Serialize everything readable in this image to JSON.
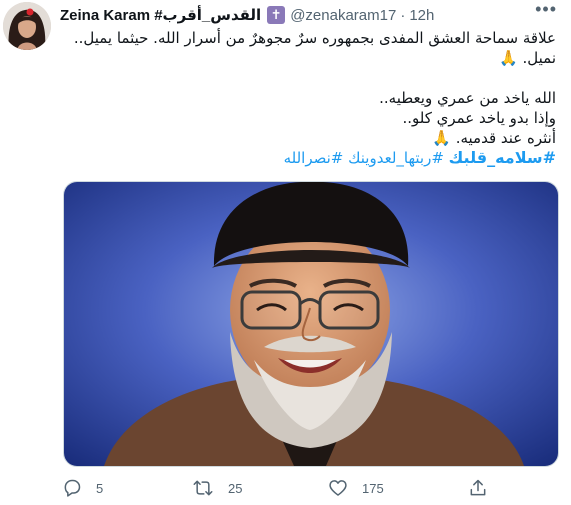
{
  "tweet": {
    "display_name": "Zeina Karam #القدس_أقرب",
    "badge_glyph": "✝",
    "handle": "@zenakaram17",
    "separator": "·",
    "time": "12h",
    "more_label": "•••",
    "lines": [
      "علاقة سماحة العشق المفدى بجمهوره سرٌ مجوهرٌ من أسرار الله. حيثما يميل..",
      "نميل. 🙏",
      "",
      "الله ياخد من عمري ويعطيه..",
      "وإذا بدو ياخد عمري كلو..",
      "أنثره عند قدميه. 🙏"
    ],
    "hashtag_main": "#سلامه_قلبك",
    "hashtag_rest": " #ربتها_لعدوينك #نصرالله",
    "actions": {
      "reply_count": "5",
      "retweet_count": "25",
      "like_count": "175"
    }
  },
  "icons": {
    "avatar": "profile-photo",
    "media": "portrait-photo",
    "reply": "reply-icon",
    "retweet": "retweet-icon",
    "like": "heart-icon",
    "share": "share-icon"
  },
  "colors": {
    "text": "#0f1419",
    "secondary": "#536471",
    "link": "#1d9bf0",
    "badge": "#8a79b8",
    "media_bg": "#2c3e8c"
  }
}
